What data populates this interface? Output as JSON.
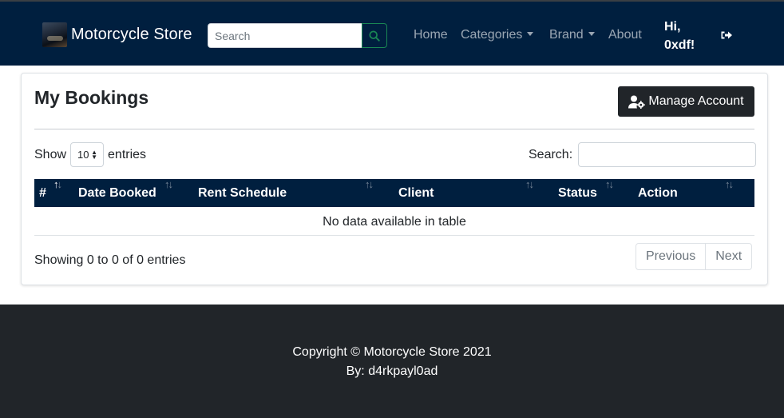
{
  "navbar": {
    "brand": "Motorcycle Store",
    "search_placeholder": "Search",
    "search_button_icon": "search-icon",
    "links": [
      {
        "label": "Home"
      },
      {
        "label": "Categories"
      },
      {
        "label": "Brand"
      },
      {
        "label": "About"
      }
    ],
    "greeting_line1": "Hi,",
    "greeting_line2": "0xdf!",
    "logout_icon": "sign-out-icon",
    "background": "#001f3f"
  },
  "bookings": {
    "title": "My Bookings",
    "manage_button": "Manage Account",
    "manage_icon": "user-cog-icon",
    "show_label": "Show",
    "page_length": "10",
    "entries_label": "entries",
    "search_label": "Search:",
    "columns": [
      "#",
      "Date Booked",
      "Rent Schedule",
      "Client",
      "Status",
      "Action"
    ],
    "empty_message": "No data available in table",
    "info": "Showing 0 to 0 of 0 entries",
    "pager": {
      "previous": "Previous",
      "next": "Next"
    }
  },
  "footer": {
    "copyright": "Copyright © Motorcycle Store 2021",
    "author": "By: d4rkpayl0ad",
    "background": "#212529"
  }
}
